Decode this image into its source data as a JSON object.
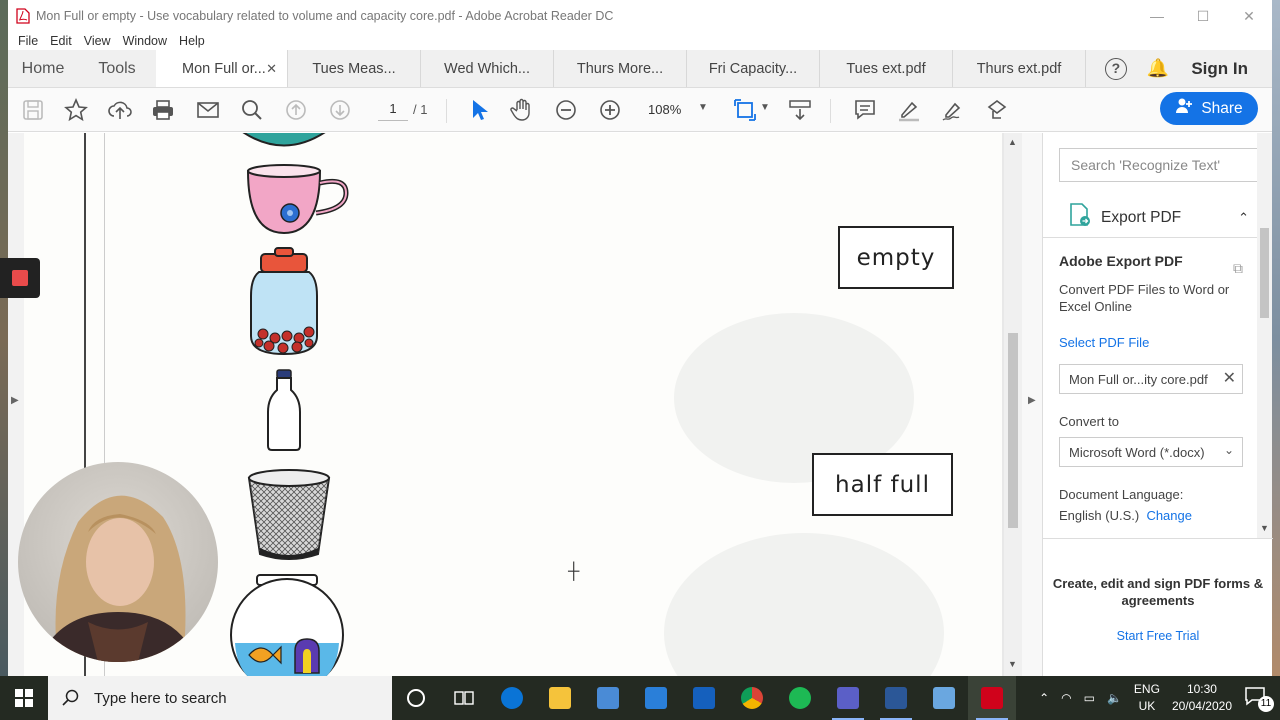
{
  "window": {
    "title": "Mon Full or empty - Use vocabulary related to volume and capacity core.pdf - Adobe Acrobat Reader DC",
    "controls": [
      "—",
      "☐",
      "✕"
    ]
  },
  "menu": [
    "File",
    "Edit",
    "View",
    "Window",
    "Help"
  ],
  "tabs": {
    "home": "Home",
    "tools": "Tools",
    "active": "Mon Full or...",
    "docs": [
      "Tues Meas...",
      "Wed Which...",
      "Thurs More...",
      "Fri Capacity...",
      "Tues ext.pdf",
      "Thurs ext.pdf"
    ],
    "help": "?",
    "signin": "Sign In"
  },
  "toolbar": {
    "page_current": "1",
    "page_total": "/ 1",
    "zoom": "108%",
    "share": "Share"
  },
  "document": {
    "labels": [
      "empty",
      "half full"
    ]
  },
  "right_panel": {
    "search_placeholder": "Search 'Recognize Text'",
    "export_title": "Export PDF",
    "heading": "Adobe Export PDF",
    "description": "Convert PDF Files to Word or Excel Online",
    "select_file": "Select PDF File",
    "file_name": "Mon Full or...ity core.pdf",
    "convert_to": "Convert to",
    "format": "Microsoft Word (*.docx)",
    "doc_language": "Document Language:",
    "language": "English (U.S.)",
    "change": "Change",
    "promo": "Create, edit and sign PDF forms & agreements",
    "trial": "Start Free Trial"
  },
  "taskbar": {
    "search_placeholder": "Type here to search",
    "lang_top": "ENG",
    "lang_bottom": "UK",
    "time": "10:30",
    "date": "20/04/2020",
    "notifications": "11"
  }
}
